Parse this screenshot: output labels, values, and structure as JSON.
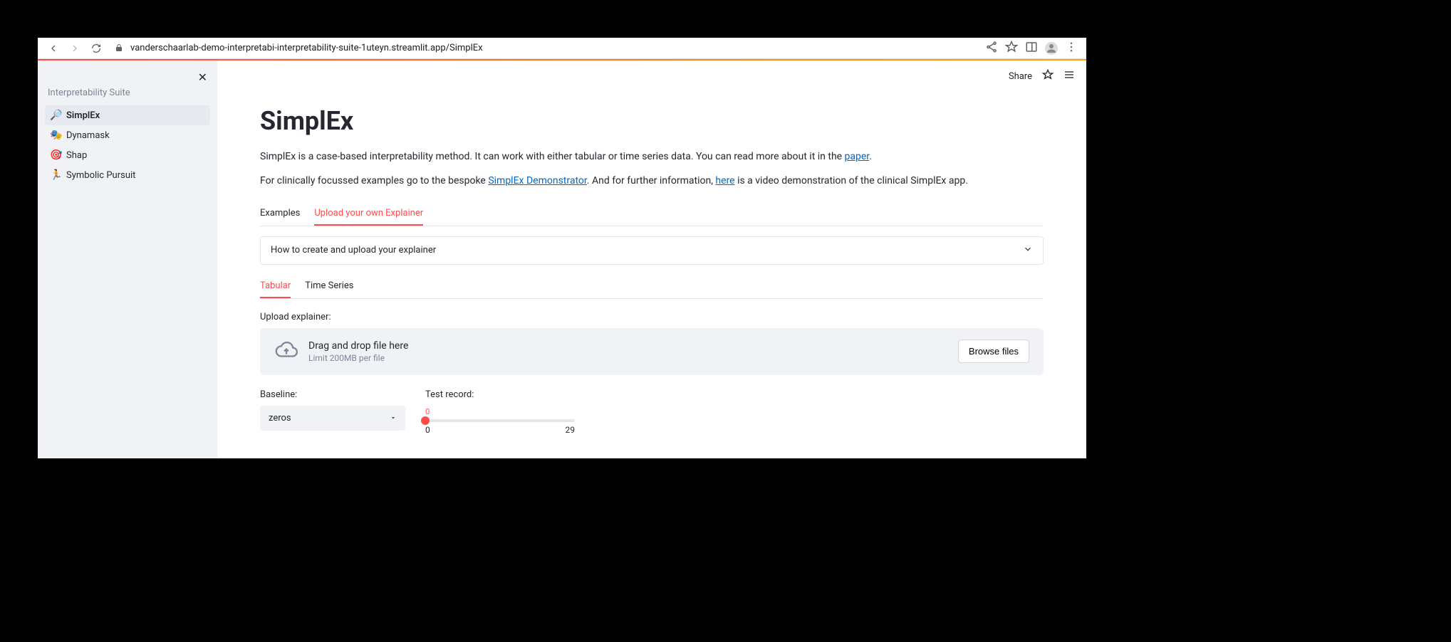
{
  "colors": {
    "accent": "#ff4b4b",
    "link": "#0068c9",
    "sidebar_bg": "#f0f2f6"
  },
  "browser": {
    "url": "vanderschaarlab-demo-interpretabi-interpretability-suite-1uteyn.streamlit.app/SimplEx"
  },
  "sidebar": {
    "title": "Interpretability Suite",
    "items": [
      {
        "icon": "🔎",
        "label": "SimplEx",
        "active": true
      },
      {
        "icon": "🎭",
        "label": "Dynamask",
        "active": false
      },
      {
        "icon": "🎯",
        "label": "Shap",
        "active": false
      },
      {
        "icon": "🏃",
        "label": "Symbolic Pursuit",
        "active": false
      }
    ]
  },
  "header_actions": {
    "share": "Share"
  },
  "page": {
    "title": "SimplEx",
    "para1_a": "SimplEx is a case-based interpretability method. It can work with either tabular or time series data. You can read more about it in the ",
    "para1_link": "paper",
    "para1_b": ".",
    "para2_a": "For clinically focussed examples go to the bespoke ",
    "para2_link1": "SimplEx Demonstrator",
    "para2_b": ". And for further information, ",
    "para2_link2": "here",
    "para2_c": " is a video demonstration of the clinical SimplEx app.",
    "tabs": [
      "Examples",
      "Upload your own Explainer"
    ],
    "tabs_active_index": 1,
    "expander_label": "How to create and upload your explainer",
    "sub_tabs": [
      "Tabular",
      "Time Series"
    ],
    "sub_tabs_active_index": 0,
    "upload_label": "Upload explainer:",
    "upload_main": "Drag and drop file here",
    "upload_sub": "Limit 200MB per file",
    "browse_label": "Browse files",
    "baseline_label": "Baseline:",
    "baseline_value": "zeros",
    "test_label": "Test record:",
    "slider": {
      "value": 0,
      "min": 0,
      "max": 29
    }
  }
}
